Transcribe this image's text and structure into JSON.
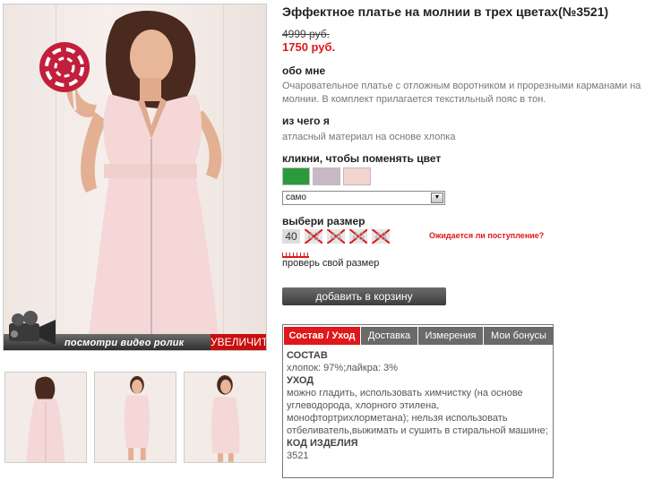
{
  "product": {
    "title": "Эффектное платье на молнии в трех цветах(№3521)",
    "old_price": "4999 руб.",
    "new_price": "1750 руб."
  },
  "about": {
    "heading": "обо мне",
    "text": "Очаровательное платье с отложным воротником и прорезными карманами на молнии. В комплект прилагается текстильный пояс в тон."
  },
  "material": {
    "heading": "из чего я",
    "text": "атласный материал на основе хлопка"
  },
  "color": {
    "heading": "кликни, чтобы поменять цвет",
    "swatches": [
      {
        "name": "green",
        "color": "#2a9a3a"
      },
      {
        "name": "lilac",
        "color": "#c9b9c4"
      },
      {
        "name": "pink",
        "color": "#f3d4cc"
      }
    ],
    "selected": "само"
  },
  "size": {
    "heading": "выбери размер",
    "options": [
      {
        "label": "40",
        "available": true
      },
      {
        "label": "42",
        "available": false
      },
      {
        "label": "44",
        "available": false
      },
      {
        "label": "46",
        "available": false
      },
      {
        "label": "48",
        "available": false
      }
    ],
    "expect_link": "Ожидается ли поступление?",
    "check_size": "проверь свой размер"
  },
  "cart_button": "добавить в корзину",
  "tabs": [
    {
      "label": "Состав / Уход",
      "active": true
    },
    {
      "label": "Доставка",
      "active": false
    },
    {
      "label": "Измерения",
      "active": false
    },
    {
      "label": "Мои бонусы",
      "active": false
    }
  ],
  "tab_content": {
    "composition_heading": "СОСТАВ",
    "composition": "хлопок: 97%;лайкра: 3%",
    "care_heading": "УХОД",
    "care": "можно гладить, использовать химчистку (на основе углеводорода, хлорного этилена, монофтортрихлорметана); нельзя использовать отбеливатель,выжимать и сушить в стиральной машине;",
    "code_heading": "КОД ИЗДЕЛИЯ",
    "code": "3521"
  },
  "media": {
    "video_label": "посмотри видео ролик",
    "zoom_label": "УВЕЛИЧИТЬ"
  },
  "colors": {
    "accent": "#e0171b",
    "button": "#555555",
    "dress": "#f4d7d6"
  }
}
